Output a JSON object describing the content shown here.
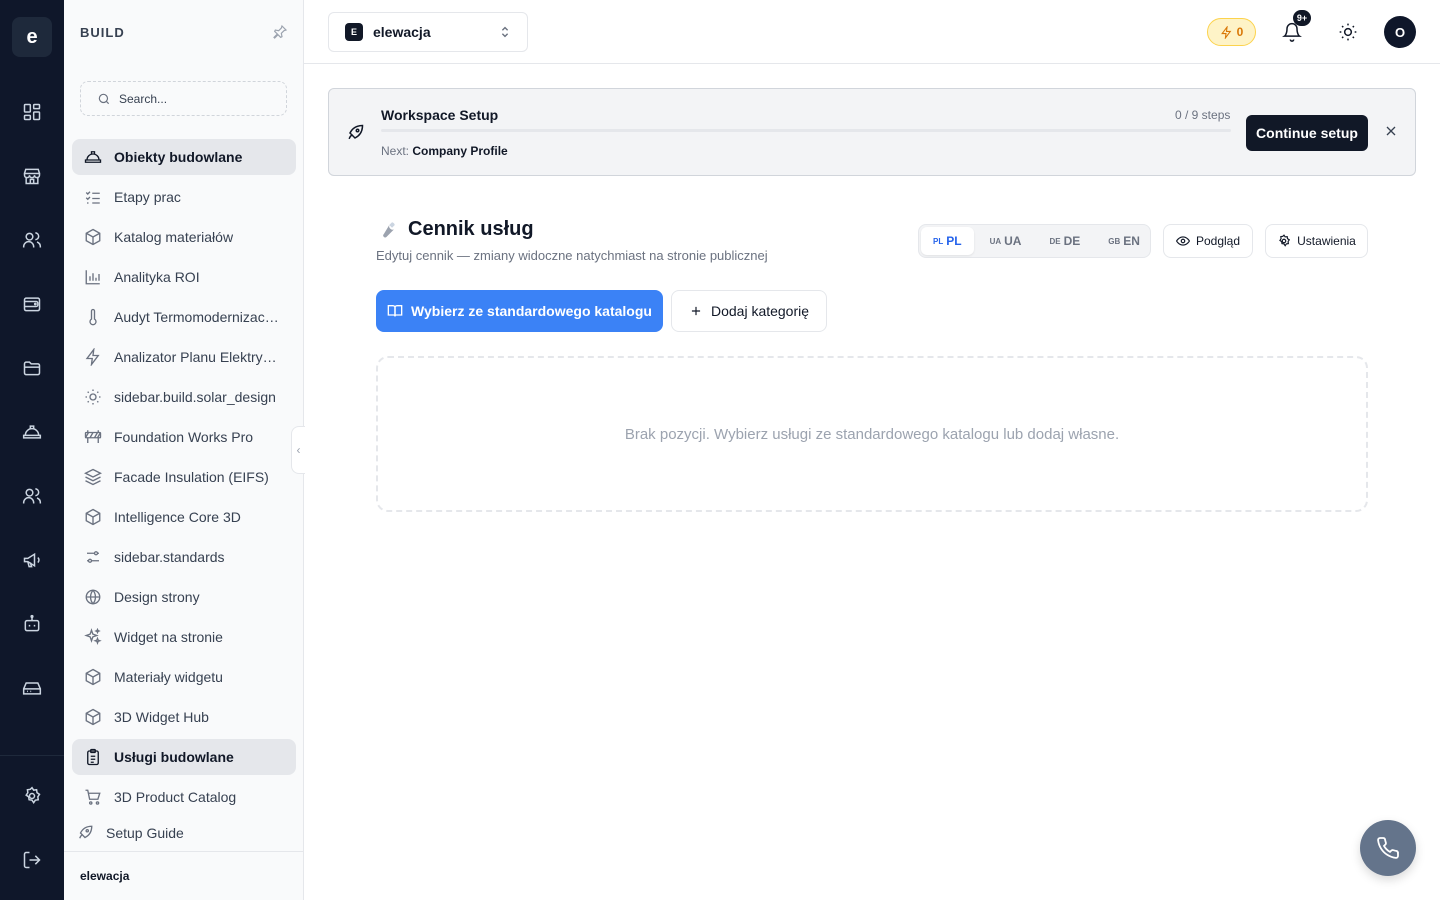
{
  "rail": {
    "logo_letter": "e",
    "icons": [
      "dashboard-icon",
      "store-icon",
      "users-icon",
      "wallet-icon",
      "folder-icon",
      "construction-helmet-icon",
      "team-icon",
      "megaphone-icon",
      "bot-icon",
      "storage-icon",
      "settings-icon",
      "logout-icon"
    ]
  },
  "sidebar": {
    "title": "BUILD",
    "search_placeholder": "Search...",
    "items": [
      {
        "label": "Obiekty budowlane",
        "icon": "helmet-icon",
        "active": true
      },
      {
        "label": "Etapy prac",
        "icon": "checklist-icon",
        "active": false
      },
      {
        "label": "Katalog materiałów",
        "icon": "box-icon",
        "active": false
      },
      {
        "label": "Analityka ROI",
        "icon": "bar-chart-icon",
        "active": false
      },
      {
        "label": "Audyt Termomodernizacyjny",
        "icon": "thermometer-icon",
        "active": false
      },
      {
        "label": "Analizator Planu Elektrycznego",
        "icon": "bolt-icon",
        "active": false
      },
      {
        "label": "sidebar.build.solar_design",
        "icon": "sun-icon",
        "active": false
      },
      {
        "label": "Foundation Works Pro",
        "icon": "barrier-icon",
        "active": false
      },
      {
        "label": "Facade Insulation (EIFS)",
        "icon": "layers-icon",
        "active": false
      },
      {
        "label": "Intelligence Core 3D",
        "icon": "box-icon",
        "active": false
      },
      {
        "label": "sidebar.standards",
        "icon": "sliders-icon",
        "active": false
      },
      {
        "label": "Design strony",
        "icon": "globe-icon",
        "active": false
      },
      {
        "label": "Widget na stronie",
        "icon": "sparkles-icon",
        "active": false
      },
      {
        "label": "Materiały widgetu",
        "icon": "box-icon",
        "active": false
      },
      {
        "label": "3D Widget Hub",
        "icon": "box-icon",
        "active": false
      },
      {
        "label": "Usługi budowlane",
        "icon": "clipboard-icon",
        "active": true
      },
      {
        "label": "3D Product Catalog",
        "icon": "cart-icon",
        "active": false
      }
    ],
    "setup_guide": "Setup Guide",
    "footer_workspace": "elewacja"
  },
  "topbar": {
    "workspace_letter": "E",
    "workspace_name": "elewacja",
    "credits": "0",
    "notifications_count": "9+",
    "avatar_letter": "O"
  },
  "setup_banner": {
    "title": "Workspace Setup",
    "steps": "0 / 9 steps",
    "progress": 0,
    "next_label": "Next:",
    "next_value": "Company Profile",
    "continue_label": "Continue setup"
  },
  "main": {
    "title": "Cennik usług",
    "subtitle": "Edytuj cennik — zmiany widoczne natychmiast na stronie publicznej",
    "languages": [
      {
        "code": "PL",
        "label": "PL",
        "active": true
      },
      {
        "code": "UA",
        "label": "UA",
        "active": false
      },
      {
        "code": "DE",
        "label": "DE",
        "active": false
      },
      {
        "code": "GB",
        "label": "EN",
        "active": false
      }
    ],
    "preview_label": "Podgląd",
    "settings_label": "Ustawienia",
    "catalog_button": "Wybierz ze standardowego katalogu",
    "add_category_button": "Dodaj kategorię",
    "empty_message": "Brak pozycji. Wybierz usługi ze standardowego katalogu lub dodaj własne."
  },
  "colors": {
    "rail_bg": "#0f172a",
    "primary": "#3b82f6",
    "dark_button": "#111827",
    "credits_accent": "#d97706"
  }
}
